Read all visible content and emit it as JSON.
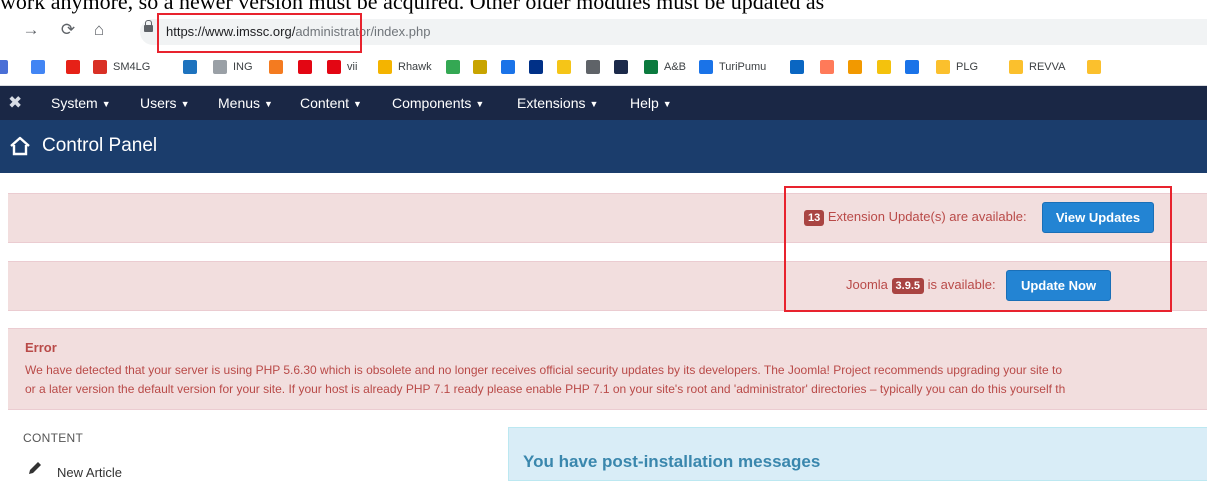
{
  "doc": {
    "overlay_text": "work anymore, so a newer version must be acquired. Other older modules must be updated as"
  },
  "browser": {
    "url_domain": "https://www.imssc.org/",
    "url_path": "administrator/index.php",
    "bookmarks": [
      {
        "label": "",
        "icon": "bookmark-square-icon",
        "color": "#4a6fd6"
      },
      {
        "label": "",
        "icon": "youtube-icon",
        "color": "#e62117"
      },
      {
        "label": "SM4LG",
        "icon": "square-red-icon",
        "color": "#d93025"
      },
      {
        "label": "",
        "icon": "cloud-icon",
        "color": "#1e73be"
      },
      {
        "label": "ING",
        "icon": "page-icon",
        "color": "#9aa0a6"
      },
      {
        "label": "",
        "icon": "bk-icon",
        "color": "#f47b20"
      },
      {
        "label": "",
        "icon": "santander-icon",
        "color": "#e30613"
      },
      {
        "label": "vii",
        "icon": "santander-icon",
        "color": "#e30613"
      },
      {
        "label": "Rhawk",
        "icon": "arc-icon",
        "color": "#f4b400"
      },
      {
        "label": "",
        "icon": "dots-icon",
        "color": "#34a853"
      },
      {
        "label": "",
        "icon": "badge-icon",
        "color": "#c8a400"
      },
      {
        "label": "",
        "icon": "c-icon",
        "color": "#1a73e8"
      },
      {
        "label": "",
        "icon": "paypal-icon",
        "color": "#003087"
      },
      {
        "label": "",
        "icon": "imdb-icon",
        "color": "#f5c518"
      },
      {
        "label": "",
        "icon": "film-icon",
        "color": "#5f6368"
      },
      {
        "label": "",
        "icon": "xe-icon",
        "color": "#1c2a4a"
      },
      {
        "label": "A&B",
        "icon": "wifi-icon",
        "color": "#0b7a3e"
      },
      {
        "label": "TuriPumu",
        "icon": "drop-icon",
        "color": "#1a73e8"
      },
      {
        "label": "",
        "icon": "linkedin-icon",
        "color": "#0a66c2"
      },
      {
        "label": "",
        "icon": "hubspot-icon",
        "color": "#ff7a59"
      },
      {
        "label": "",
        "icon": "box-icon",
        "color": "#f29900"
      },
      {
        "label": "",
        "icon": "e-icon",
        "color": "#f4c20d"
      },
      {
        "label": "",
        "icon": "r-icon",
        "color": "#1a73e8"
      },
      {
        "label": "PLG",
        "icon": "folder-icon",
        "color": "#fbc02d"
      },
      {
        "label": "REVVA",
        "icon": "folder-icon",
        "color": "#fbc02d"
      }
    ]
  },
  "joomla": {
    "menu": [
      "System",
      "Users",
      "Menus",
      "Content",
      "Components",
      "Extensions",
      "Help"
    ],
    "header_title": "Control Panel",
    "extension_alert": {
      "count": "13",
      "text": "Extension Update(s) are available:",
      "button": "View Updates"
    },
    "joomla_alert": {
      "prefix": "Joomla",
      "version": "3.9.5",
      "text": "is available:",
      "button": "Update Now"
    },
    "error": {
      "title": "Error",
      "line1": "We have detected that your server is using PHP 5.6.30 which is obsolete and no longer receives official security updates by its developers. The Joomla! Project recommends upgrading your site to",
      "line2": "or a later version the default version for your site. If your host is already PHP 7.1 ready please enable PHP 7.1 on your site's root and 'administrator' directories – typically you can do this yourself th"
    },
    "sidebar": {
      "section": "CONTENT",
      "new_article": "New Article"
    },
    "post_install": {
      "title": "You have post-installation messages"
    }
  },
  "colors": {
    "nav_bg": "#1a2745",
    "header_bg": "#1b3d6c",
    "alert_bg": "#f2dede",
    "alert_text": "#b94a48",
    "button_blue": "#2384d3",
    "highlight_red": "#e8232e",
    "info_bg": "#d9edf7",
    "info_text": "#3a87ad"
  }
}
